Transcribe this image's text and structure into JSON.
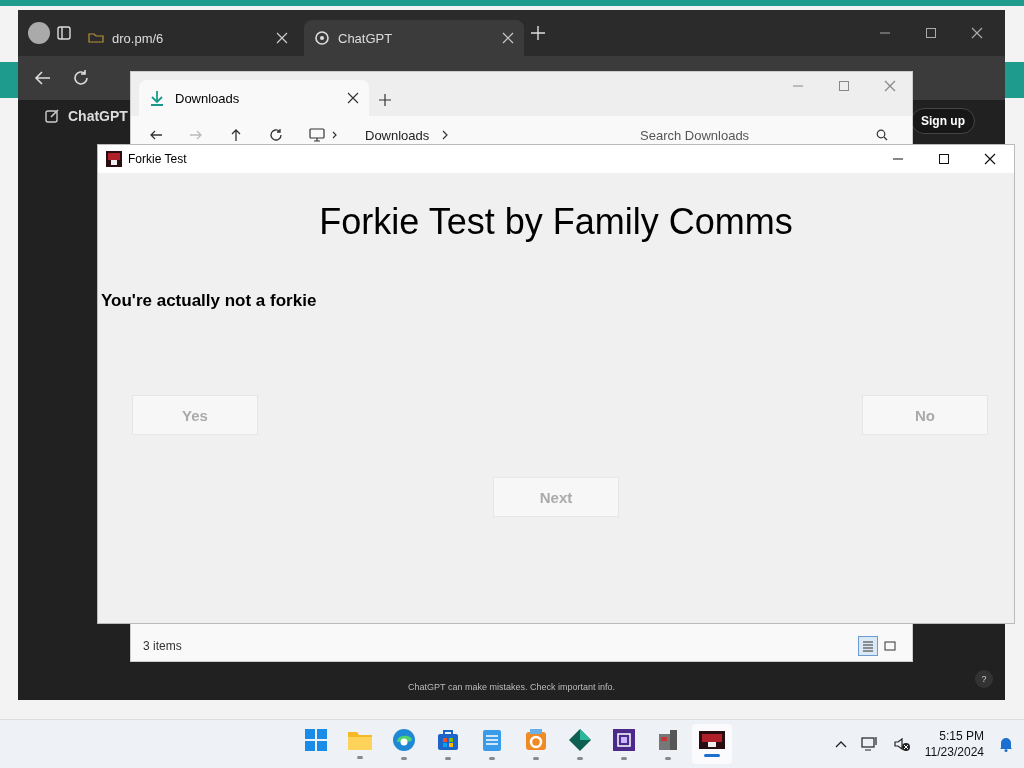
{
  "browser": {
    "tabs": [
      {
        "title": "dro.pm/6",
        "selected": false
      },
      {
        "title": "ChatGPT",
        "selected": true
      }
    ],
    "page": {
      "brand": "ChatGPT",
      "signup": "Sign up",
      "footer": "ChatGPT can make mistakes. Check important info.",
      "help": "?"
    }
  },
  "explorer": {
    "tab": "Downloads",
    "breadcrumb": "Downloads",
    "search": {
      "placeholder": "Search Downloads"
    },
    "status": "3 items",
    "views": [
      {
        "kind": "details",
        "selected": true
      },
      {
        "kind": "tiles",
        "selected": false
      }
    ]
  },
  "dialog": {
    "title": "Forkie Test",
    "heading": "Forkie Test by Family Comms",
    "message": "You're actually not a forkie",
    "buttons": [
      {
        "label": "Yes",
        "disabled": true
      },
      {
        "label": "No",
        "disabled": true
      },
      {
        "label": "Next",
        "disabled": true
      }
    ]
  },
  "taskbar": {
    "apps": [
      {
        "kind": "start",
        "running": false,
        "selected": false
      },
      {
        "kind": "folder",
        "running": true,
        "selected": false
      },
      {
        "kind": "edge",
        "running": true,
        "selected": false
      },
      {
        "kind": "store",
        "running": true,
        "selected": false
      },
      {
        "kind": "notepad",
        "running": true,
        "selected": false
      },
      {
        "kind": "letter",
        "running": true,
        "selected": false
      },
      {
        "kind": "diamond",
        "running": true,
        "selected": false
      },
      {
        "kind": "chip",
        "running": true,
        "selected": false
      },
      {
        "kind": "tool",
        "running": true,
        "selected": false
      },
      {
        "kind": "forkie",
        "running": true,
        "selected": true
      }
    ],
    "time": "5:15 PM",
    "date": "11/23/2024"
  }
}
